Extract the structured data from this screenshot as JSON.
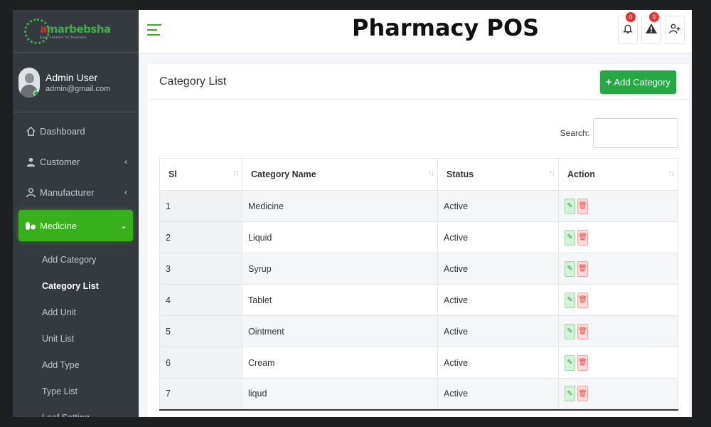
{
  "brand": {
    "name_a": "a",
    "name_rest": "marbebsha",
    "tagline": "Easy solution for business"
  },
  "user": {
    "name": "Admin User",
    "email": "admin@gmail.com"
  },
  "nav": {
    "items": [
      {
        "label": "Dashboard",
        "icon": "home-icon"
      },
      {
        "label": "Customer",
        "icon": "users-icon"
      },
      {
        "label": "Manufacturer",
        "icon": "factory-icon"
      },
      {
        "label": "Medicine",
        "icon": "pills-icon"
      }
    ],
    "sub_items": [
      "Add Category",
      "Category List",
      "Add Unit",
      "Unit List",
      "Add Type",
      "Type List",
      "Leaf Setting"
    ]
  },
  "header": {
    "title": "Pharmacy POS",
    "notifications_count": "0",
    "alerts_count": "9"
  },
  "card": {
    "title": "Category List",
    "add_button": "Add Category",
    "search_label": "Search:",
    "search_value": ""
  },
  "table": {
    "columns": [
      "Sl",
      "Category Name",
      "Status",
      "Action"
    ],
    "rows": [
      {
        "sl": "1",
        "name": "Medicine",
        "status": "Active"
      },
      {
        "sl": "2",
        "name": "Liquid",
        "status": "Active"
      },
      {
        "sl": "3",
        "name": "Syrup",
        "status": "Active"
      },
      {
        "sl": "4",
        "name": "Tablet",
        "status": "Active"
      },
      {
        "sl": "5",
        "name": "Ointment",
        "status": "Active"
      },
      {
        "sl": "6",
        "name": "Cream",
        "status": "Active"
      },
      {
        "sl": "7",
        "name": "liqud",
        "status": "Active"
      }
    ]
  },
  "colors": {
    "accent": "#38b01b",
    "sidebar": "#343a40",
    "danger": "#e3342f"
  }
}
